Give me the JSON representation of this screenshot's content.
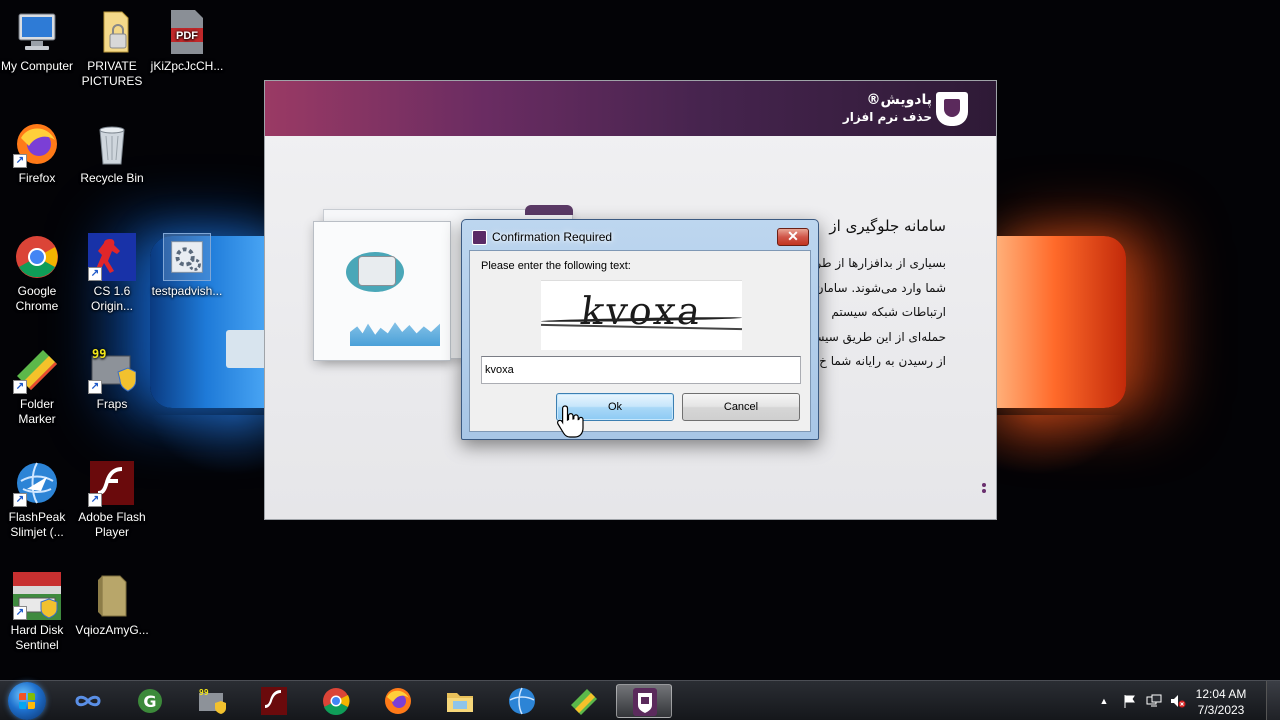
{
  "desktop": {
    "icons": [
      {
        "label": "My Computer",
        "icon": "computer-icon"
      },
      {
        "label": "PRIVATE PICTURES",
        "icon": "locked-folder-icon"
      },
      {
        "label": "jKiZpcJcCH...",
        "icon": "pdf-icon"
      },
      {
        "label": "Firefox",
        "icon": "firefox-icon"
      },
      {
        "label": "Recycle Bin",
        "icon": "recycle-bin-icon"
      },
      {
        "label": "Google Chrome",
        "icon": "chrome-icon"
      },
      {
        "label": "CS 1.6 Origin...",
        "icon": "counter-strike-icon"
      },
      {
        "label": "testpadvish...",
        "icon": "settings-file-icon"
      },
      {
        "label": "Folder Marker",
        "icon": "folder-marker-icon"
      },
      {
        "label": "Fraps",
        "icon": "fraps-icon"
      },
      {
        "label": "FlashPeak Slimjet (...",
        "icon": "slimjet-icon"
      },
      {
        "label": "Adobe Flash Player",
        "icon": "flash-icon"
      },
      {
        "label": "Hard Disk Sentinel",
        "icon": "hard-disk-sentinel-icon"
      },
      {
        "label": "VqiozAmyG...",
        "icon": "folder-icon"
      }
    ]
  },
  "app": {
    "brand_name": "پادویش®",
    "brand_subtitle": "حذف نرم افزار",
    "heading": "سامانه جلوگیری از",
    "paragraph_lines": [
      "بسیاری از بدافزارها از طری",
      "شما وارد می‌شوند. سامان",
      "ارتباطات شبکه سیستم",
      "حمله‌ای از این طریق سیست",
      "از رسیدن به رایانه شما خ"
    ]
  },
  "dialog": {
    "title": "Confirmation Required",
    "close_symbol": "✕",
    "prompt": "Please enter the following text:",
    "captcha_text": "kvoxa",
    "input_value": "kvoxa",
    "ok_label": "Ok",
    "cancel_label": "Cancel"
  },
  "taskbar": {
    "pinned": [
      {
        "icon": "infinity-app-icon"
      },
      {
        "icon": "grammarly-icon"
      },
      {
        "icon": "fraps-icon"
      },
      {
        "icon": "flash-icon"
      },
      {
        "icon": "chrome-icon"
      },
      {
        "icon": "firefox-icon"
      },
      {
        "icon": "file-explorer-icon"
      },
      {
        "icon": "slimjet-icon"
      },
      {
        "icon": "folder-marker-icon"
      },
      {
        "icon": "padvish-icon",
        "active": true
      }
    ],
    "tray": {
      "up_arrow": "▲",
      "time": "12:04 AM",
      "date": "7/3/2023"
    }
  }
}
